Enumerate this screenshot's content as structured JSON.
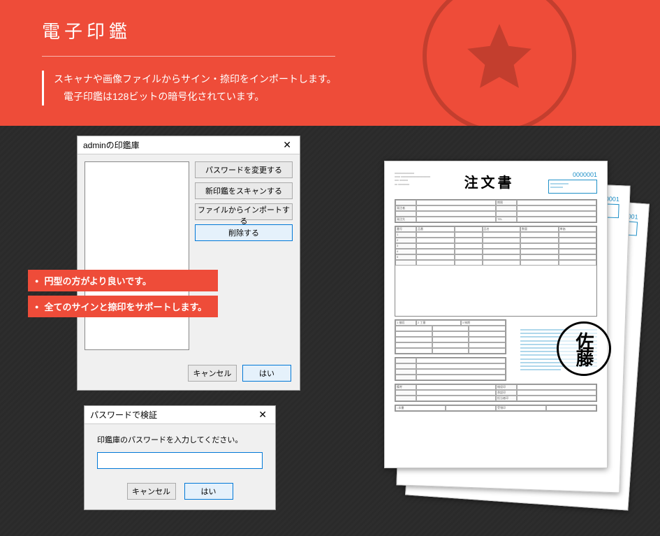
{
  "header": {
    "title": "電子印鑑",
    "desc_line1": "スキャナや画像ファイルからサイン・捺印をインポートします。",
    "desc_line2": "電子印鑑は128ビットの暗号化されています。"
  },
  "dialog1": {
    "title": "adminの印鑑庫",
    "close": "✕",
    "buttons": {
      "change_password": "パスワードを変更する",
      "scan_new": "新印鑑をスキャンする",
      "import_file": "ファイルからインポートする",
      "delete": "削除する"
    },
    "cancel": "キャンセル",
    "ok": "はい"
  },
  "dialog2": {
    "title": "パスワードで検証",
    "close": "✕",
    "prompt": "印鑑庫のパスワードを入力してください。",
    "input_value": "",
    "cancel": "キャンセル",
    "ok": "はい"
  },
  "tags": {
    "t1": "円型の方がより良いです。",
    "t2": "全てのサインと捺印をサポートします。"
  },
  "document": {
    "title": "注文書",
    "number": "0000001",
    "hanko": "佐藤"
  }
}
